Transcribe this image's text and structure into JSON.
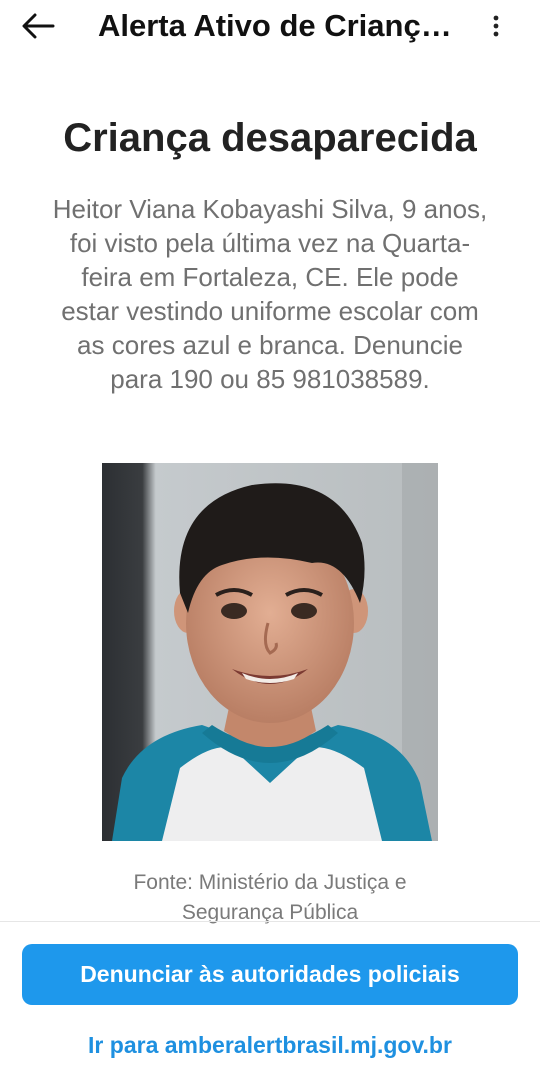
{
  "header": {
    "back_icon": "arrow-left-icon",
    "title": "Alerta Ativo de Criança desaparecida",
    "more_icon": "more-vertical-icon"
  },
  "alert": {
    "headline": "Criança desaparecida",
    "description": "Heitor Viana Kobayashi Silva, 9 anos, foi visto pela última vez na Quarta-feira em Fortaleza, CE. Ele pode estar vestindo uniforme escolar com as cores azul e branca. Denuncie para 190 ou 85 981038589.",
    "photo_subject": "missing-child-photo",
    "source": "Fonte: Ministério da Justiça e Segurança Pública"
  },
  "actions": {
    "report_button": "Denunciar às autoridades policiais",
    "site_link": "Ir para amberalertbrasil.mj.gov.br"
  },
  "colors": {
    "accent": "#1e98ec",
    "link": "#1e90e0",
    "body_text": "#707070"
  }
}
